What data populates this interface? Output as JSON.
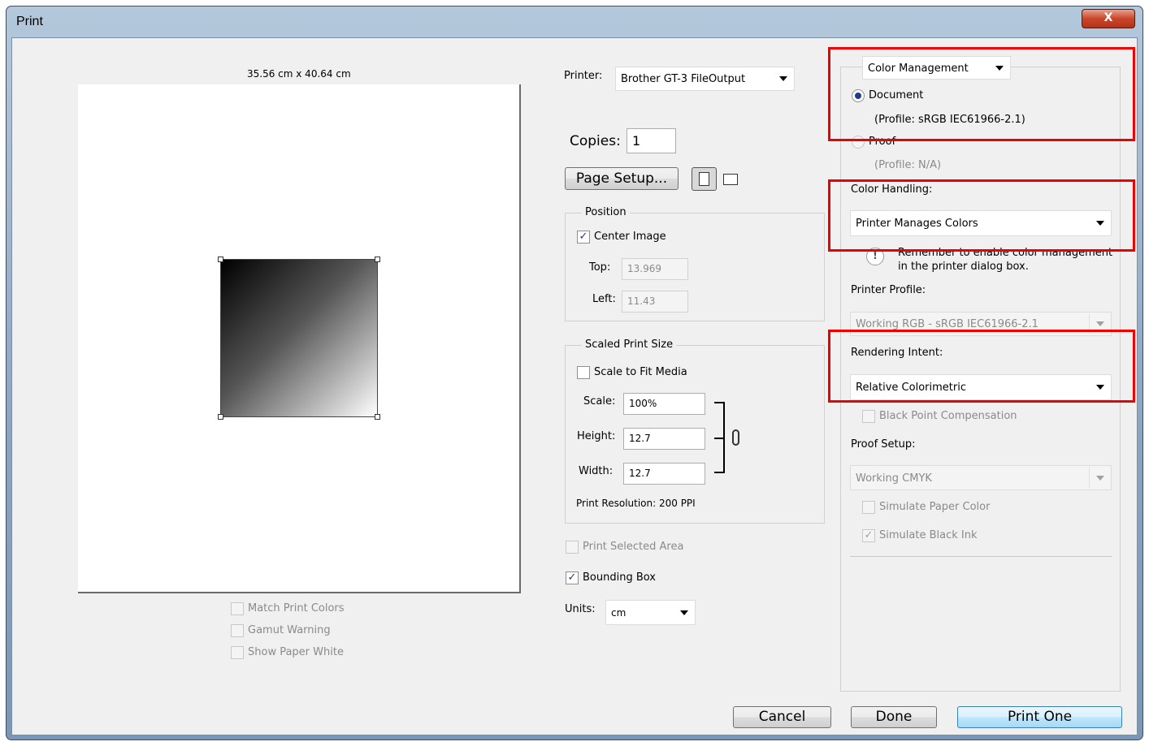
{
  "window": {
    "title": "Print",
    "close_glyph": "X"
  },
  "preview": {
    "dimensions": "35.56 cm x 40.64 cm",
    "options": [
      {
        "label": "Match Print Colors",
        "checked": false,
        "disabled": true
      },
      {
        "label": "Gamut Warning",
        "checked": false,
        "disabled": true
      },
      {
        "label": "Show Paper White",
        "checked": false,
        "disabled": true
      }
    ]
  },
  "printer": {
    "label": "Printer:",
    "value": "Brother GT-3 FileOutput"
  },
  "copies": {
    "label": "Copies:",
    "value": "1"
  },
  "page_setup": {
    "label": "Page Setup..."
  },
  "position": {
    "title": "Position",
    "center_image": {
      "label": "Center Image",
      "checked": true
    },
    "top": {
      "label": "Top:",
      "value": "13.969"
    },
    "left": {
      "label": "Left:",
      "value": "11.43"
    }
  },
  "scaled": {
    "title": "Scaled Print Size",
    "scale_to_fit": {
      "label": "Scale to Fit Media",
      "checked": false
    },
    "scale": {
      "label": "Scale:",
      "value": "100%"
    },
    "height": {
      "label": "Height:",
      "value": "12.7"
    },
    "width": {
      "label": "Width:",
      "value": "12.7"
    },
    "resolution": "Print Resolution: 200 PPI"
  },
  "print_selected_area": {
    "label": "Print Selected Area",
    "checked": false
  },
  "bounding_box": {
    "label": "Bounding Box",
    "checked": true
  },
  "units": {
    "label": "Units:",
    "value": "cm"
  },
  "color": {
    "section": "Color Management",
    "document": {
      "label": "Document",
      "profile": "(Profile: sRGB IEC61966-2.1)"
    },
    "proof": {
      "label": "Proof",
      "profile": "(Profile: N/A)"
    },
    "handling": {
      "label": "Color Handling:",
      "value": "Printer Manages Colors"
    },
    "note_line1": "Remember to enable color management",
    "note_line2": "in the printer dialog box.",
    "printer_profile": {
      "label": "Printer Profile:",
      "value": "Working RGB - sRGB IEC61966-2.1"
    },
    "rendering_intent": {
      "label": "Rendering Intent:",
      "value": "Relative Colorimetric"
    },
    "black_point": {
      "label": "Black Point Compensation",
      "checked": false
    },
    "proof_setup": {
      "label": "Proof Setup:",
      "value": "Working CMYK"
    },
    "simulate_paper": {
      "label": "Simulate Paper Color",
      "checked": false
    },
    "simulate_black": {
      "label": "Simulate Black Ink",
      "checked": true
    }
  },
  "buttons": {
    "cancel": "Cancel",
    "done": "Done",
    "print_one": "Print One"
  },
  "colors": {
    "highlight_box": "#ee0000",
    "accent": "#1b3d8a"
  }
}
